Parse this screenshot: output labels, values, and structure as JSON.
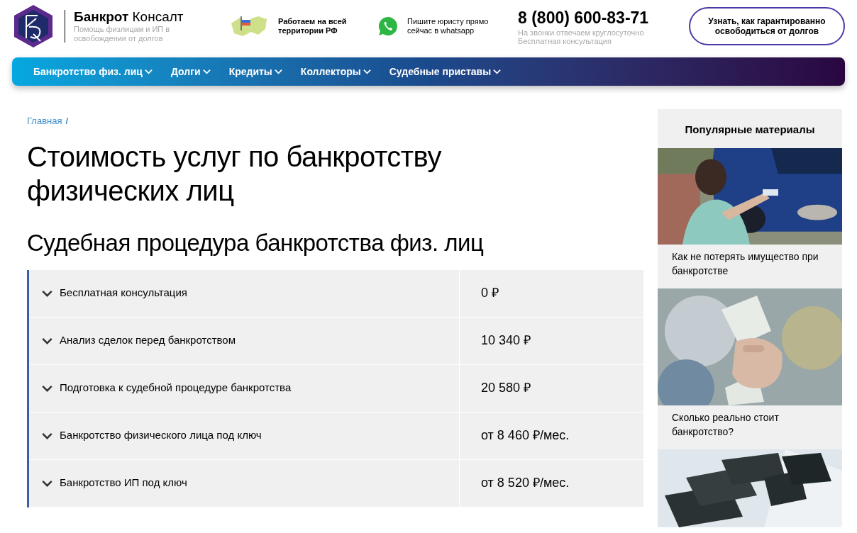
{
  "header": {
    "brand_bold": "Банкрот",
    "brand_rest": "Консалт",
    "tagline": "Помощь физлицам и ИП в освобождении от долгов",
    "region_note": "Работаем на всей территории РФ",
    "whatsapp_note": "Пишите юристу прямо сейчас в whatsapp",
    "phone": "8 (800) 600-83-71",
    "phone_note": "На звонки отвечаем круглосуточно Бесплатная консультация",
    "cta": "Узнать, как гарантированно освободиться от долгов"
  },
  "nav": [
    {
      "label": "Банкротство физ. лиц"
    },
    {
      "label": "Долги"
    },
    {
      "label": "Кредиты"
    },
    {
      "label": "Коллекторы"
    },
    {
      "label": "Судебные приставы"
    }
  ],
  "breadcrumb": [
    {
      "label": "Главная"
    }
  ],
  "breadcrumb_separator": "/",
  "title": "Стоимость услуг по банкротству физических лиц",
  "subtitle": "Судебная процедура банкротства физ. лиц",
  "prices": [
    {
      "service": "Бесплатная консультация",
      "price": "0 ₽",
      "expanded": false
    },
    {
      "service": "Анализ сделок перед банкротством",
      "price": "10 340 ₽",
      "expanded": false
    },
    {
      "service": "Подготовка к судебной процедуре банкротства",
      "price": "20 580 ₽",
      "expanded": false
    },
    {
      "service": "Банкротство физического лица под ключ",
      "price": "от 8 460 ₽/мес.",
      "expanded": false
    },
    {
      "service": "Банкротство ИП под ключ",
      "price": "от 8 520 ₽/мес.",
      "expanded": false
    }
  ],
  "sidebar": {
    "title": "Популярные материалы",
    "articles": [
      {
        "kind": "picture",
        "title": "Как не потерять имущество при банкротстве"
      },
      {
        "kind": "picture",
        "title": "Сколько реально стоит банкротство?"
      },
      {
        "kind": "picture"
      }
    ]
  }
}
